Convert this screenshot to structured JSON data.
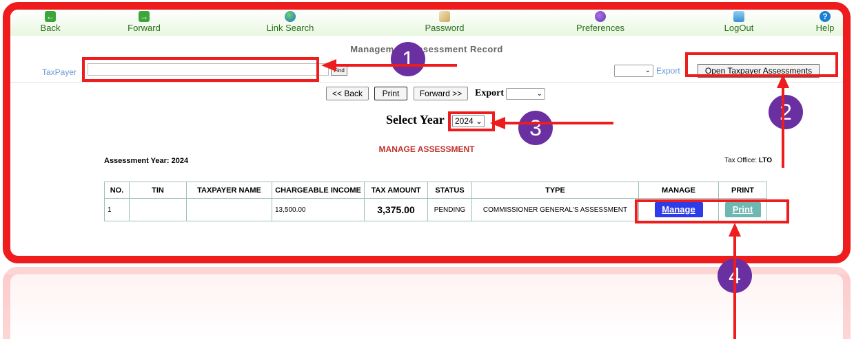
{
  "toolbar": {
    "items": [
      {
        "label": "Back",
        "icon": "back-arrow-icon"
      },
      {
        "label": "Forward",
        "icon": "forward-arrow-icon"
      },
      {
        "label": "Link Search",
        "icon": "globe-icon"
      },
      {
        "label": "Password",
        "icon": "password-icon"
      },
      {
        "label": "Preferences",
        "icon": "preferences-icon"
      },
      {
        "label": "LogOut",
        "icon": "logout-icon"
      },
      {
        "label": "Help",
        "icon": "help-icon"
      }
    ]
  },
  "page_title": "Management Assessment Record",
  "taxpayer": {
    "label": "TaxPayer",
    "value": "",
    "find_label": "Find"
  },
  "export_top": {
    "selected": "",
    "link_label": "Export"
  },
  "open_assessments_label": "Open Taxpayer Assessments",
  "nav_buttons": {
    "back": "<< Back",
    "print": "Print",
    "forward": "Forward >>"
  },
  "export_mid": {
    "label": "Export",
    "selected": ""
  },
  "select_year": {
    "label": "Select Year",
    "value": "2024"
  },
  "manage_title": "MANAGE ASSESSMENT",
  "assessment_year_text": "Assessment Year: 2024",
  "tax_office": {
    "label": "Tax Office:",
    "value": "LTO"
  },
  "table": {
    "headers": [
      "NO.",
      "TIN",
      "TAXPAYER NAME",
      "CHARGEABLE INCOME",
      "TAX AMOUNT",
      "STATUS",
      "TYPE",
      "MANAGE",
      "PRINT"
    ],
    "rows": [
      {
        "no": "1",
        "tin": "",
        "name": "",
        "income": "13,500.00",
        "tax": "3,375.00",
        "status": "PENDING",
        "type": "COMMISSIONER GENERAL'S ASSESSMENT",
        "manage": "Manage",
        "print": "Print"
      }
    ]
  },
  "annotations": [
    "1",
    "2",
    "3",
    "4"
  ],
  "colors": {
    "highlight": "#ee1c1c",
    "badge": "#6a2fa0",
    "manage_btn": "#2e3be8",
    "print_btn": "#6fb8b2",
    "title_red": "#c0322c"
  }
}
